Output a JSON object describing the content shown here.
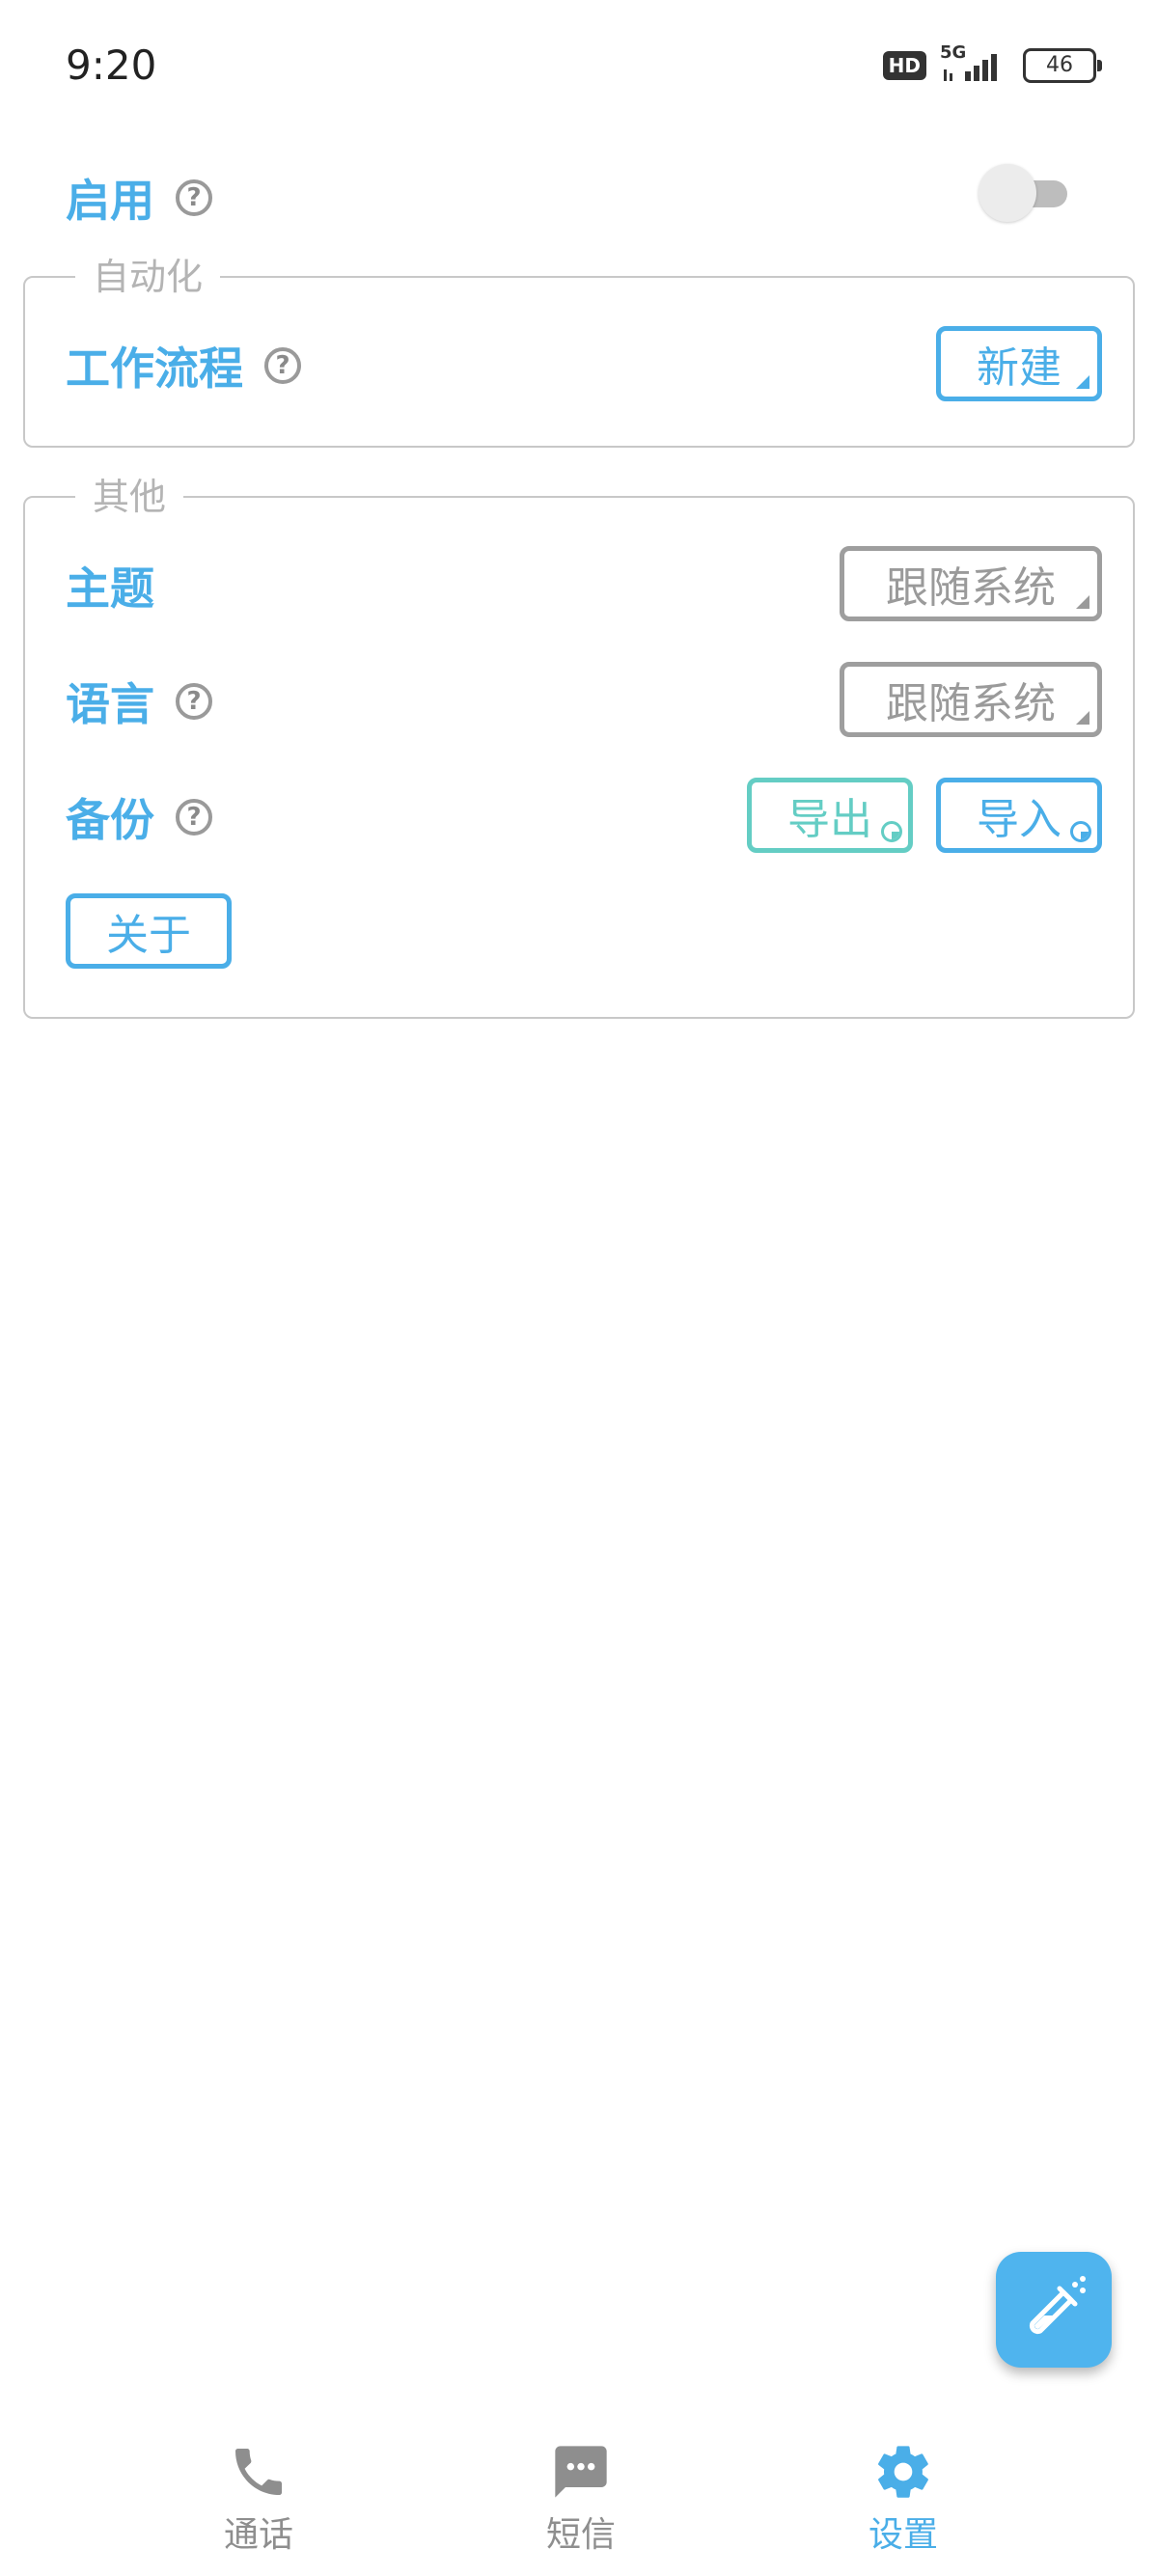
{
  "status_bar": {
    "time": "9:20",
    "hd_label": "HD",
    "network_label": "5G",
    "battery_level": "46"
  },
  "enable": {
    "label": "启用",
    "help_symbol": "?",
    "toggle_on": false
  },
  "automation": {
    "legend": "自动化",
    "workflow_label": "工作流程",
    "help_symbol": "?",
    "new_button": "新建"
  },
  "other": {
    "legend": "其他",
    "theme_label": "主题",
    "theme_value": "跟随系统",
    "language_label": "语言",
    "language_value": "跟随系统",
    "backup_label": "备份",
    "export_button": "导出",
    "import_button": "导入",
    "about_button": "关于",
    "help_symbol": "?"
  },
  "fab": {
    "icon": "test-tube-icon"
  },
  "bottom_nav": {
    "items": [
      {
        "label": "通话",
        "icon": "phone-icon",
        "active": false
      },
      {
        "label": "短信",
        "icon": "message-icon",
        "active": false
      },
      {
        "label": "设置",
        "icon": "gear-icon",
        "active": true
      }
    ]
  },
  "colors": {
    "accent": "#4aaee8",
    "teal": "#64cdc4",
    "gray": "#9e9e9e"
  }
}
